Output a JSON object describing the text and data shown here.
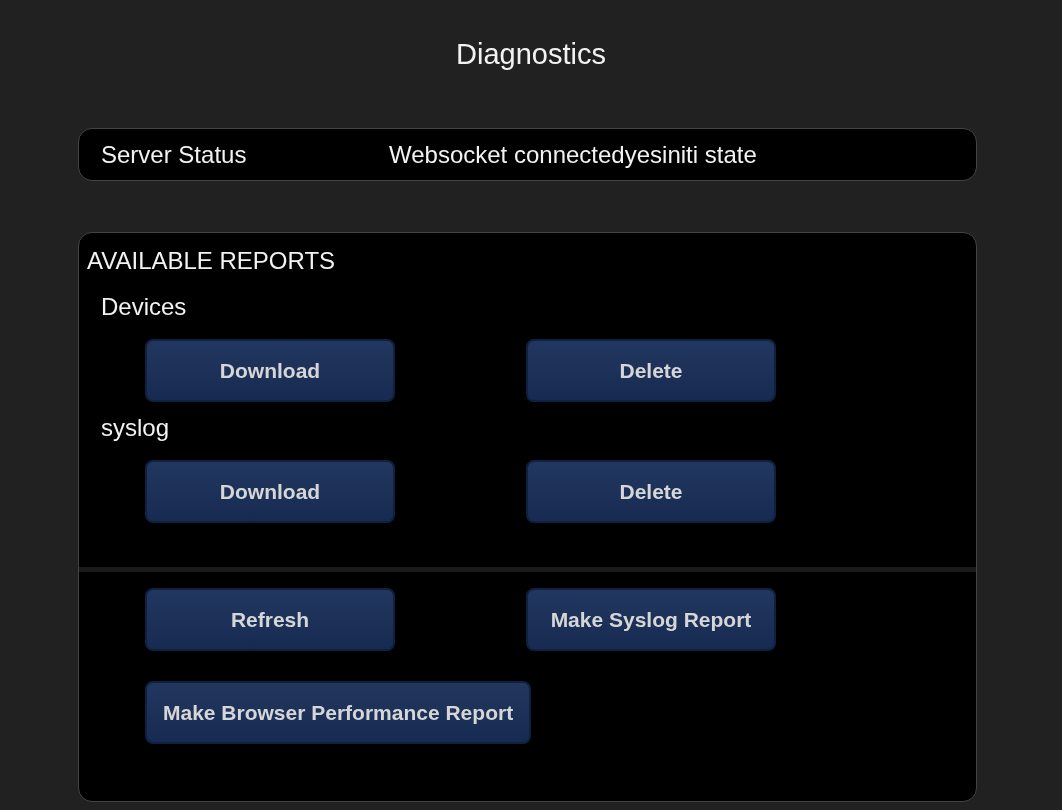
{
  "title": "Diagnostics",
  "server_status": {
    "label": "Server Status",
    "value": "Websocket connectedyesiniti state"
  },
  "reports": {
    "heading": "AVAILABLE REPORTS",
    "items": [
      {
        "name": "Devices",
        "buttons": [
          "Download",
          "Delete"
        ]
      },
      {
        "name": "syslog",
        "buttons": [
          "Download",
          "Delete"
        ]
      }
    ],
    "actions": [
      [
        "Refresh",
        "Make Syslog Report"
      ],
      [
        "Make Browser Performance Report"
      ]
    ]
  }
}
